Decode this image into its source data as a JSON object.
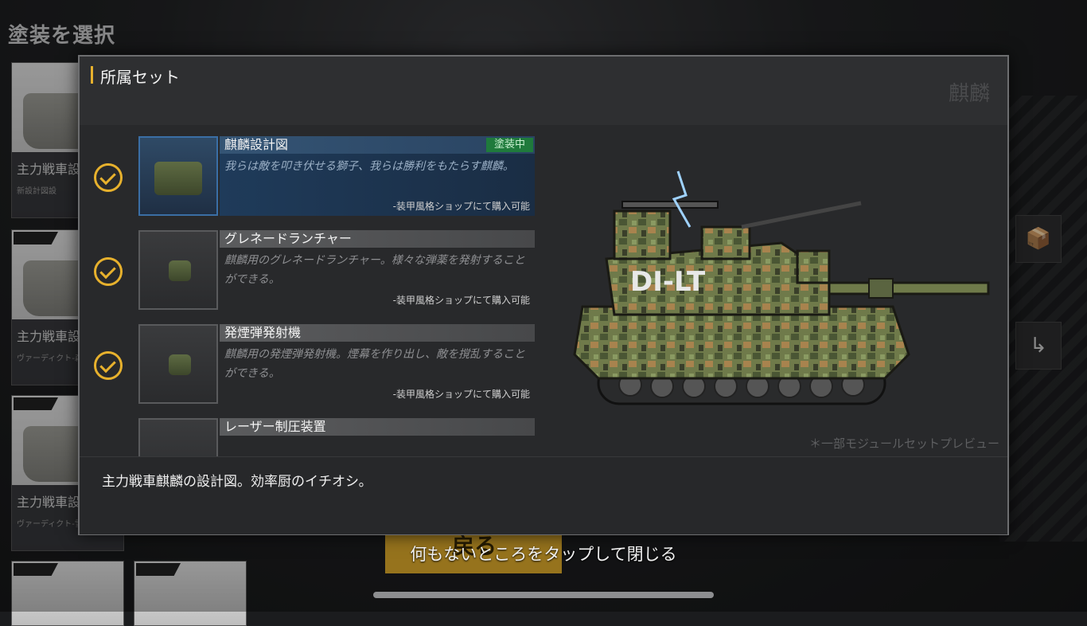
{
  "screen": {
    "title": "塗装を選択",
    "skin_cards": [
      {
        "name": "主力戦車設",
        "sub": "新設計図設"
      },
      {
        "name": "主力戦車設",
        "sub": "ヴァーディクト-森林"
      },
      {
        "name": "主力戦車設",
        "sub": "ヴァーディクト-雪原"
      },
      {
        "name": "",
        "sub": ""
      }
    ],
    "side_buttons": [
      {
        "icon": "box-icon",
        "glyph": "📦"
      },
      {
        "icon": "arrow-return-icon",
        "glyph": "↳"
      }
    ],
    "back_button_label": "戻る",
    "tap_to_close": "何もないところをタップして閉じる"
  },
  "modal": {
    "title": "所属セット",
    "set_name": "麒麟",
    "modules": [
      {
        "name": "麒麟設計図",
        "badge": "塗装中",
        "description": "我らは敵を叩き伏せる獅子、我らは勝利をもたらす麒麟。",
        "shop": "-装甲風格ショップにて購入可能",
        "owned": true,
        "selected": true
      },
      {
        "name": "グレネードランチャー",
        "badge": "",
        "description": "麒麟用のグレネードランチャー。様々な弾薬を発射することができる。",
        "shop": "-装甲風格ショップにて購入可能",
        "owned": true,
        "selected": false
      },
      {
        "name": "発煙弾発射機",
        "badge": "",
        "description": "麒麟用の発煙弾発射機。煙幕を作り出し、敵を撹乱することができる。",
        "shop": "-装甲風格ショップにて購入可能",
        "owned": true,
        "selected": false
      },
      {
        "name": "レーザー制圧装置",
        "badge": "",
        "description": "",
        "shop": "",
        "owned": false,
        "selected": false
      }
    ],
    "preview_note": "＊一部モジュールセットプレビュー",
    "bottom_description": "主力戦車麒麟の設計図。効率厨のイチオシ。"
  },
  "colors": {
    "accent": "#e7b12d",
    "equipped_badge": "#1f7a3c",
    "selected_row": "#1f3b5a"
  }
}
